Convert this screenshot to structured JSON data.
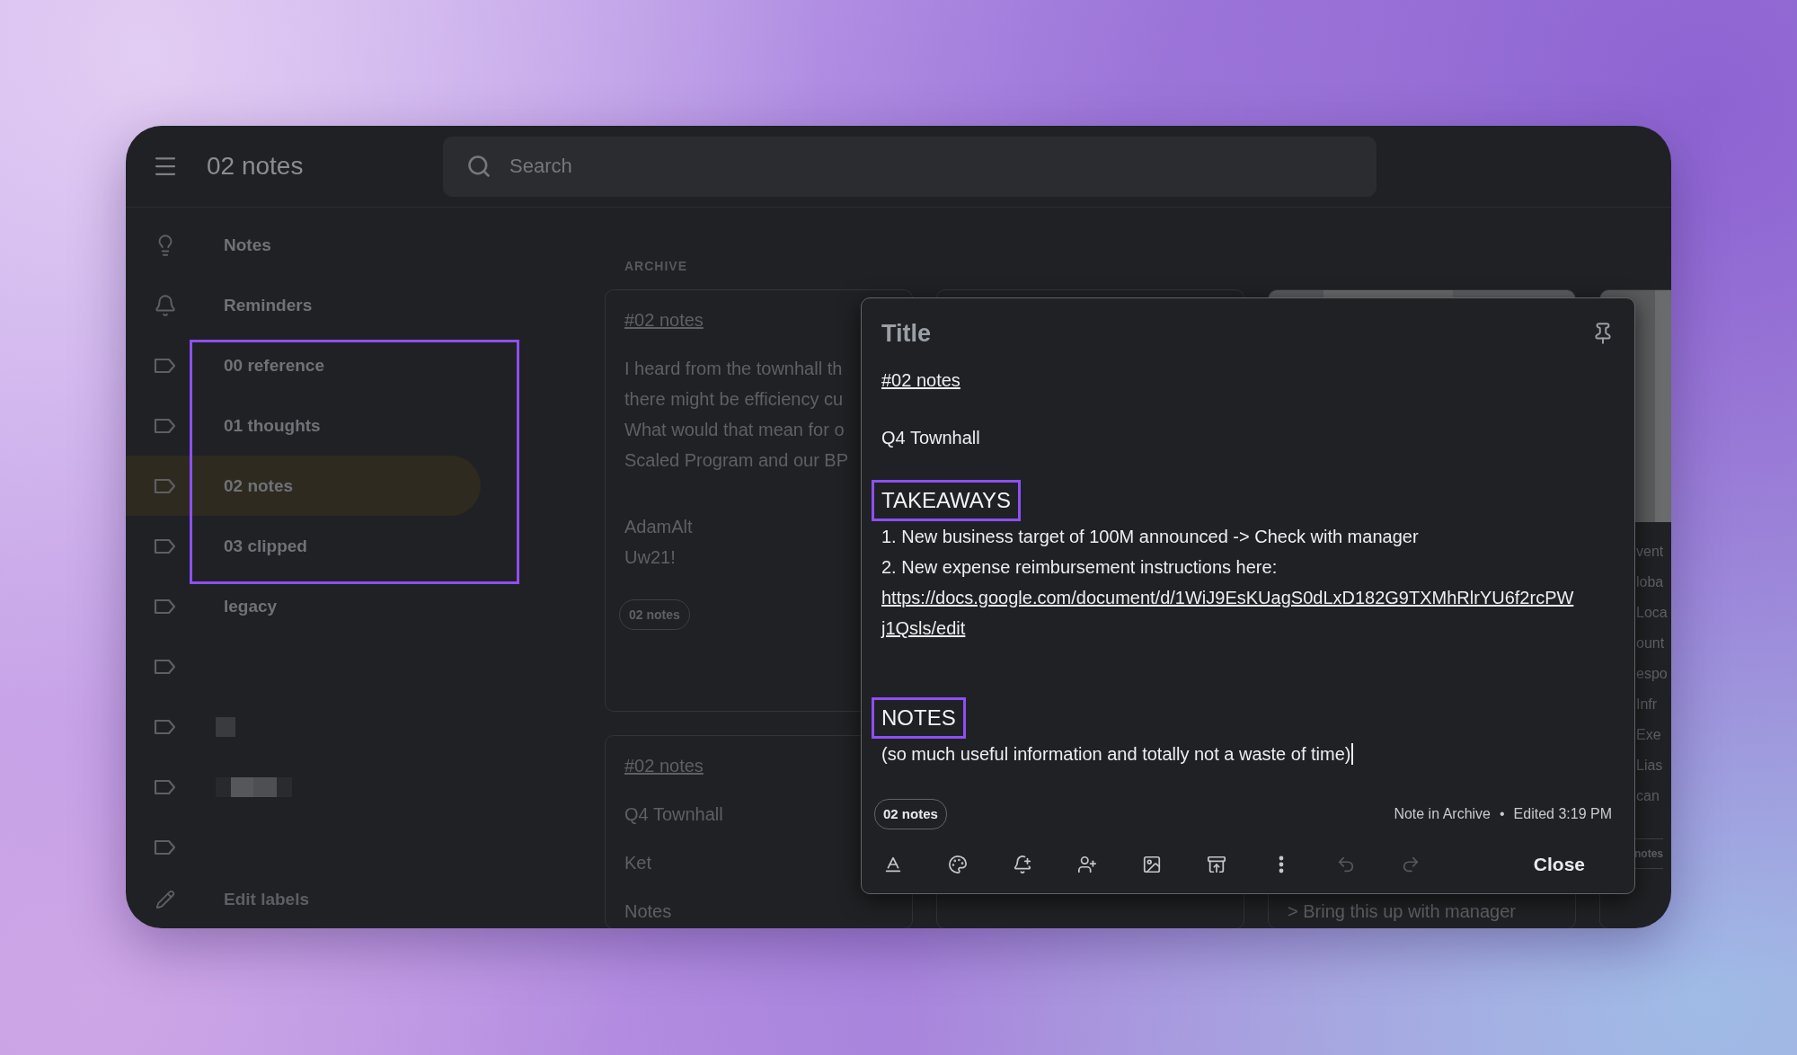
{
  "header": {
    "title": "02 notes",
    "search": {
      "placeholder": "Search"
    }
  },
  "sidebar": {
    "items": [
      {
        "kind": "nav",
        "label": "Notes",
        "selected": false,
        "annotated": false
      },
      {
        "kind": "nav",
        "label": "Reminders",
        "selected": false,
        "annotated": false
      },
      {
        "kind": "label",
        "label": "00 reference",
        "selected": false,
        "annotated": true
      },
      {
        "kind": "label",
        "label": "01 thoughts",
        "selected": false,
        "annotated": true
      },
      {
        "kind": "label",
        "label": "02 notes",
        "selected": true,
        "annotated": true
      },
      {
        "kind": "label",
        "label": "03 clipped",
        "selected": false,
        "annotated": true
      },
      {
        "kind": "label",
        "label": "legacy",
        "selected": false,
        "annotated": false
      },
      {
        "kind": "unnamed",
        "selected": false,
        "annotated": false
      },
      {
        "kind": "masked",
        "selected": false,
        "annotated": false
      },
      {
        "kind": "pixelated",
        "selected": false,
        "annotated": false
      },
      {
        "kind": "unnamed",
        "selected": false,
        "annotated": false
      }
    ],
    "edit_labels": "Edit labels"
  },
  "main": {
    "section": "ARCHIVE",
    "columns": [
      {
        "cards": [
          {
            "kind": "text",
            "lines": [
              {
                "kind": "link",
                "text": "#02 notes"
              },
              {
                "kind": "blank"
              },
              {
                "kind": "text",
                "text": "I heard from the townhall th"
              },
              {
                "kind": "text",
                "text": "there might be efficiency cu"
              },
              {
                "kind": "text",
                "text": "What would that mean for o"
              },
              {
                "kind": "text",
                "text": "Scaled Program and our BP"
              },
              {
                "kind": "blank"
              },
              {
                "kind": "blank"
              },
              {
                "kind": "text",
                "text": "AdamAlt"
              },
              {
                "kind": "text",
                "text": "Uw21!"
              }
            ],
            "tag": "02 notes"
          },
          {
            "kind": "text",
            "lines": [
              {
                "kind": "link",
                "text": "#02 notes"
              },
              {
                "kind": "blank"
              },
              {
                "kind": "text",
                "text": "Q4 Townhall"
              },
              {
                "kind": "blank"
              },
              {
                "kind": "text",
                "text": "Ket"
              },
              {
                "kind": "blank"
              },
              {
                "kind": "text",
                "text": "Notes"
              }
            ]
          }
        ]
      },
      {
        "cards": [
          {
            "kind": "text"
          }
        ]
      },
      {
        "cards": [
          {
            "kind": "image",
            "lines": [
              {
                "kind": "footer",
                "text": "> Bring this up with manager"
              }
            ]
          }
        ]
      },
      {
        "cards": [
          {
            "kind": "image",
            "lines": [
              {
                "kind": "text",
                "text": "vent"
              },
              {
                "kind": "text",
                "text": "loba"
              },
              {
                "kind": "text",
                "text": "Loca"
              },
              {
                "kind": "text",
                "text": "ount"
              },
              {
                "kind": "text",
                "text": "espo"
              },
              {
                "kind": "text",
                "text": "Infr"
              },
              {
                "kind": "text",
                "text": "Exe"
              },
              {
                "kind": "text",
                "text": "Lias"
              },
              {
                "kind": "text",
                "text": "can"
              }
            ],
            "tag": "notes"
          }
        ]
      }
    ]
  },
  "note_editor": {
    "title_placeholder": "Title",
    "lines": [
      {
        "kind": "link",
        "text": "#02 notes"
      },
      {
        "kind": "blank"
      },
      {
        "kind": "text",
        "text": "Q4 Townhall"
      },
      {
        "kind": "blank"
      },
      {
        "kind": "heading",
        "text": "TAKEAWAYS",
        "annotated": true
      },
      {
        "kind": "text",
        "text": "1. New business target of 100M announced -> Check with manager"
      },
      {
        "kind": "text",
        "text": "2. New expense reimbursement instructions here:"
      },
      {
        "kind": "link",
        "text": "https://docs.google.com/document/d/1WiJ9EsKUagS0dLxD182G9TXMhRlrYU6f2rcPW"
      },
      {
        "kind": "link",
        "text": "j1Qsls/edit"
      },
      {
        "kind": "blank"
      },
      {
        "kind": "blank"
      },
      {
        "kind": "heading",
        "text": "NOTES",
        "annotated": true
      },
      {
        "kind": "text",
        "text": "(so much useful information and totally not a waste of time)",
        "cursor": true
      }
    ],
    "tag": "02 notes",
    "location": "Note in Archive",
    "separator": "•",
    "edited": "Edited 3:19 PM",
    "toolbar": [
      {
        "kind": "format",
        "disabled": false
      },
      {
        "kind": "palette",
        "disabled": false
      },
      {
        "kind": "remind",
        "disabled": false
      },
      {
        "kind": "collaborator",
        "disabled": false
      },
      {
        "kind": "image",
        "disabled": false
      },
      {
        "kind": "unarchive",
        "disabled": false
      },
      {
        "kind": "more",
        "disabled": false
      },
      {
        "kind": "undo",
        "disabled": true
      },
      {
        "kind": "redo",
        "disabled": true
      }
    ],
    "close": "Close"
  }
}
